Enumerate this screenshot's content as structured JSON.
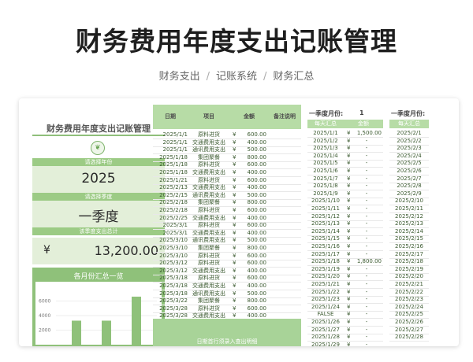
{
  "hero": {
    "title": "财务费用年度支出记账管理",
    "breadcrumb": [
      "财务支出",
      "记账系统",
      "财务汇总"
    ]
  },
  "left_panel": {
    "title": "财务费用年度支出记账管理",
    "year_label": "请选择年份",
    "year_value": "2025",
    "quarter_label": "请选择季度",
    "quarter_value": "一季度",
    "total_label": "该季度支出总计",
    "currency": "¥",
    "total_value": "13,200.00",
    "chart_title": "各月份汇总一览"
  },
  "chart_data": {
    "type": "bar",
    "title": "各月份汇总一览",
    "y_ticks": [
      "6000",
      "4000",
      "2000"
    ],
    "values": [
      3300,
      3300,
      6600
    ],
    "ylim": [
      0,
      8000
    ]
  },
  "ledger": {
    "headers": [
      "日期",
      "项目",
      "金额",
      "备注说明"
    ],
    "rows": [
      {
        "date": "2025/1/1",
        "item": "原料进货",
        "amount": "600.00"
      },
      {
        "date": "2025/1/1",
        "item": "交通费用支出",
        "amount": "400.00"
      },
      {
        "date": "2025/1/1",
        "item": "通讯费用支出",
        "amount": "500.00"
      },
      {
        "date": "2025/1/18",
        "item": "集团聚餐",
        "amount": "800.00"
      },
      {
        "date": "2025/1/18",
        "item": "原料进货",
        "amount": "600.00"
      },
      {
        "date": "2025/1/18",
        "item": "交通费用支出",
        "amount": "400.00"
      },
      {
        "date": "2025/1/21",
        "item": "原料进货",
        "amount": "600.00"
      },
      {
        "date": "2025/2/13",
        "item": "交通费用支出",
        "amount": "400.00"
      },
      {
        "date": "2025/2/15",
        "item": "通讯费用支出",
        "amount": "500.00"
      },
      {
        "date": "2025/2/18",
        "item": "集团聚餐",
        "amount": "800.00"
      },
      {
        "date": "2025/2/18",
        "item": "原料进货",
        "amount": "600.00"
      },
      {
        "date": "2025/2/25",
        "item": "交通费用支出",
        "amount": "400.00"
      },
      {
        "date": "2025/3/1",
        "item": "原料进货",
        "amount": "600.00"
      },
      {
        "date": "2025/3/1",
        "item": "交通费用支出",
        "amount": "400.00"
      },
      {
        "date": "2025/3/10",
        "item": "通讯费用支出",
        "amount": "500.00"
      },
      {
        "date": "2025/3/10",
        "item": "集团聚餐",
        "amount": "800.00"
      },
      {
        "date": "2025/3/10",
        "item": "原料进货",
        "amount": "600.00"
      },
      {
        "date": "2025/3/12",
        "item": "原料进货",
        "amount": "600.00"
      },
      {
        "date": "2025/3/12",
        "item": "交通费用支出",
        "amount": "400.00"
      },
      {
        "date": "2025/3/18",
        "item": "原料进货",
        "amount": "600.00"
      },
      {
        "date": "2025/3/18",
        "item": "交通费用支出",
        "amount": "400.00"
      },
      {
        "date": "2025/3/18",
        "item": "通讯费用支出",
        "amount": "500.00"
      },
      {
        "date": "2025/3/22",
        "item": "集团聚餐",
        "amount": "800.00"
      },
      {
        "date": "2025/3/28",
        "item": "原料进货",
        "amount": "600.00"
      },
      {
        "date": "2025/3/28",
        "item": "交通费用支出",
        "amount": "400.00"
      }
    ],
    "footer_text": "日期首行须录入查出明细"
  },
  "month1": {
    "label": "一季度月份:",
    "value": "1",
    "headers": [
      "每天汇总",
      "金额"
    ],
    "rows": [
      {
        "d": "2025/1/1",
        "a": "1,500.00"
      },
      {
        "d": "2025/1/2",
        "a": "-"
      },
      {
        "d": "2025/1/3",
        "a": "-"
      },
      {
        "d": "2025/1/4",
        "a": "-"
      },
      {
        "d": "2025/1/5",
        "a": "-"
      },
      {
        "d": "2025/1/6",
        "a": "-"
      },
      {
        "d": "2025/1/7",
        "a": "-"
      },
      {
        "d": "2025/1/8",
        "a": "-"
      },
      {
        "d": "2025/1/9",
        "a": "-"
      },
      {
        "d": "2025/1/10",
        "a": "-"
      },
      {
        "d": "2025/1/11",
        "a": "-"
      },
      {
        "d": "2025/1/12",
        "a": "-"
      },
      {
        "d": "2025/1/13",
        "a": "-"
      },
      {
        "d": "2025/1/14",
        "a": "-"
      },
      {
        "d": "2025/1/15",
        "a": "-"
      },
      {
        "d": "2025/1/16",
        "a": "-"
      },
      {
        "d": "2025/1/17",
        "a": "-"
      },
      {
        "d": "2025/1/18",
        "a": "1,800.00"
      },
      {
        "d": "2025/1/19",
        "a": "-"
      },
      {
        "d": "2025/1/20",
        "a": "-"
      },
      {
        "d": "2025/1/21",
        "a": "-"
      },
      {
        "d": "2025/1/22",
        "a": "-"
      },
      {
        "d": "2025/1/23",
        "a": "-"
      },
      {
        "d": "2025/1/24",
        "a": "-"
      },
      {
        "d": "FALSE",
        "a": "-"
      },
      {
        "d": "2025/1/26",
        "a": "-"
      },
      {
        "d": "2025/1/27",
        "a": "-"
      },
      {
        "d": "2025/1/28",
        "a": "-"
      },
      {
        "d": "2025/1/29",
        "a": "-"
      }
    ]
  },
  "month2": {
    "label": "一季度月份:",
    "headers": [
      "每天汇总"
    ],
    "rows": [
      "2025/2/1",
      "2025/2/2",
      "2025/2/3",
      "2025/2/4",
      "2025/2/5",
      "2025/2/6",
      "2025/2/7",
      "2025/2/8",
      "2025/2/9",
      "2025/2/10",
      "2025/2/11",
      "2025/2/12",
      "2025/2/13",
      "2025/2/14",
      "2025/2/15",
      "2025/2/16",
      "2025/2/17",
      "2025/2/18",
      "2025/2/19",
      "2025/2/20",
      "2025/2/21",
      "2025/2/22",
      "2025/2/23",
      "2025/2/24",
      "2025/2/25",
      "2025/2/26",
      "2025/2/27",
      "2025/2/28"
    ]
  },
  "colors": {
    "accent": "#9ccb85",
    "card": "#e3efd9",
    "header": "#b7dca6"
  }
}
